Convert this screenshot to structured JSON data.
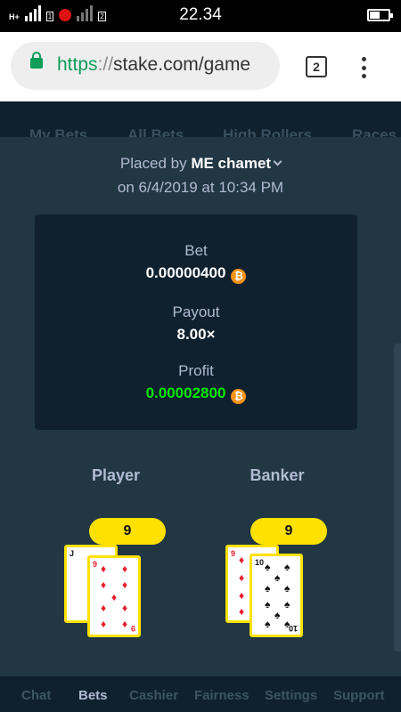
{
  "status_bar": {
    "network": "H+",
    "time": "22.34"
  },
  "browser": {
    "url_scheme": "https",
    "url_separator": "://",
    "url_host": "stake.com/game",
    "tab_count": "2"
  },
  "background_tabs": [
    "My Bets",
    "All Bets",
    "High Rollers",
    "Races"
  ],
  "bet_details": {
    "placed_by_prefix": "Placed by",
    "username": "ME chamet",
    "placed_on": "on 6/4/2019 at 10:34 PM",
    "bet_label": "Bet",
    "bet_value": "0.00000400",
    "payout_label": "Payout",
    "payout_value": "8.00×",
    "profit_label": "Profit",
    "profit_value": "0.00002800",
    "currency_symbol": "₿"
  },
  "game": {
    "player_label": "Player",
    "banker_label": "Banker",
    "player_score": "9",
    "banker_score": "9",
    "player_cards": [
      {
        "rank": "J",
        "suit": "spades",
        "color": "black"
      },
      {
        "rank": "9",
        "suit": "diamonds",
        "color": "red"
      }
    ],
    "banker_cards": [
      {
        "rank": "9",
        "suit": "diamonds",
        "color": "red"
      },
      {
        "rank": "10",
        "suit": "spades",
        "color": "black"
      }
    ]
  },
  "bottom_nav": {
    "items": [
      "Chat",
      "Bets",
      "Cashier",
      "Fairness",
      "Settings",
      "Support"
    ],
    "active": "Bets"
  },
  "colors": {
    "background": "#1a2c38",
    "modal": "#213743",
    "stats_box": "#0f212e",
    "profit_green": "#00e701",
    "score_badge": "#ffe100",
    "bitcoin_orange": "#f7931a"
  }
}
